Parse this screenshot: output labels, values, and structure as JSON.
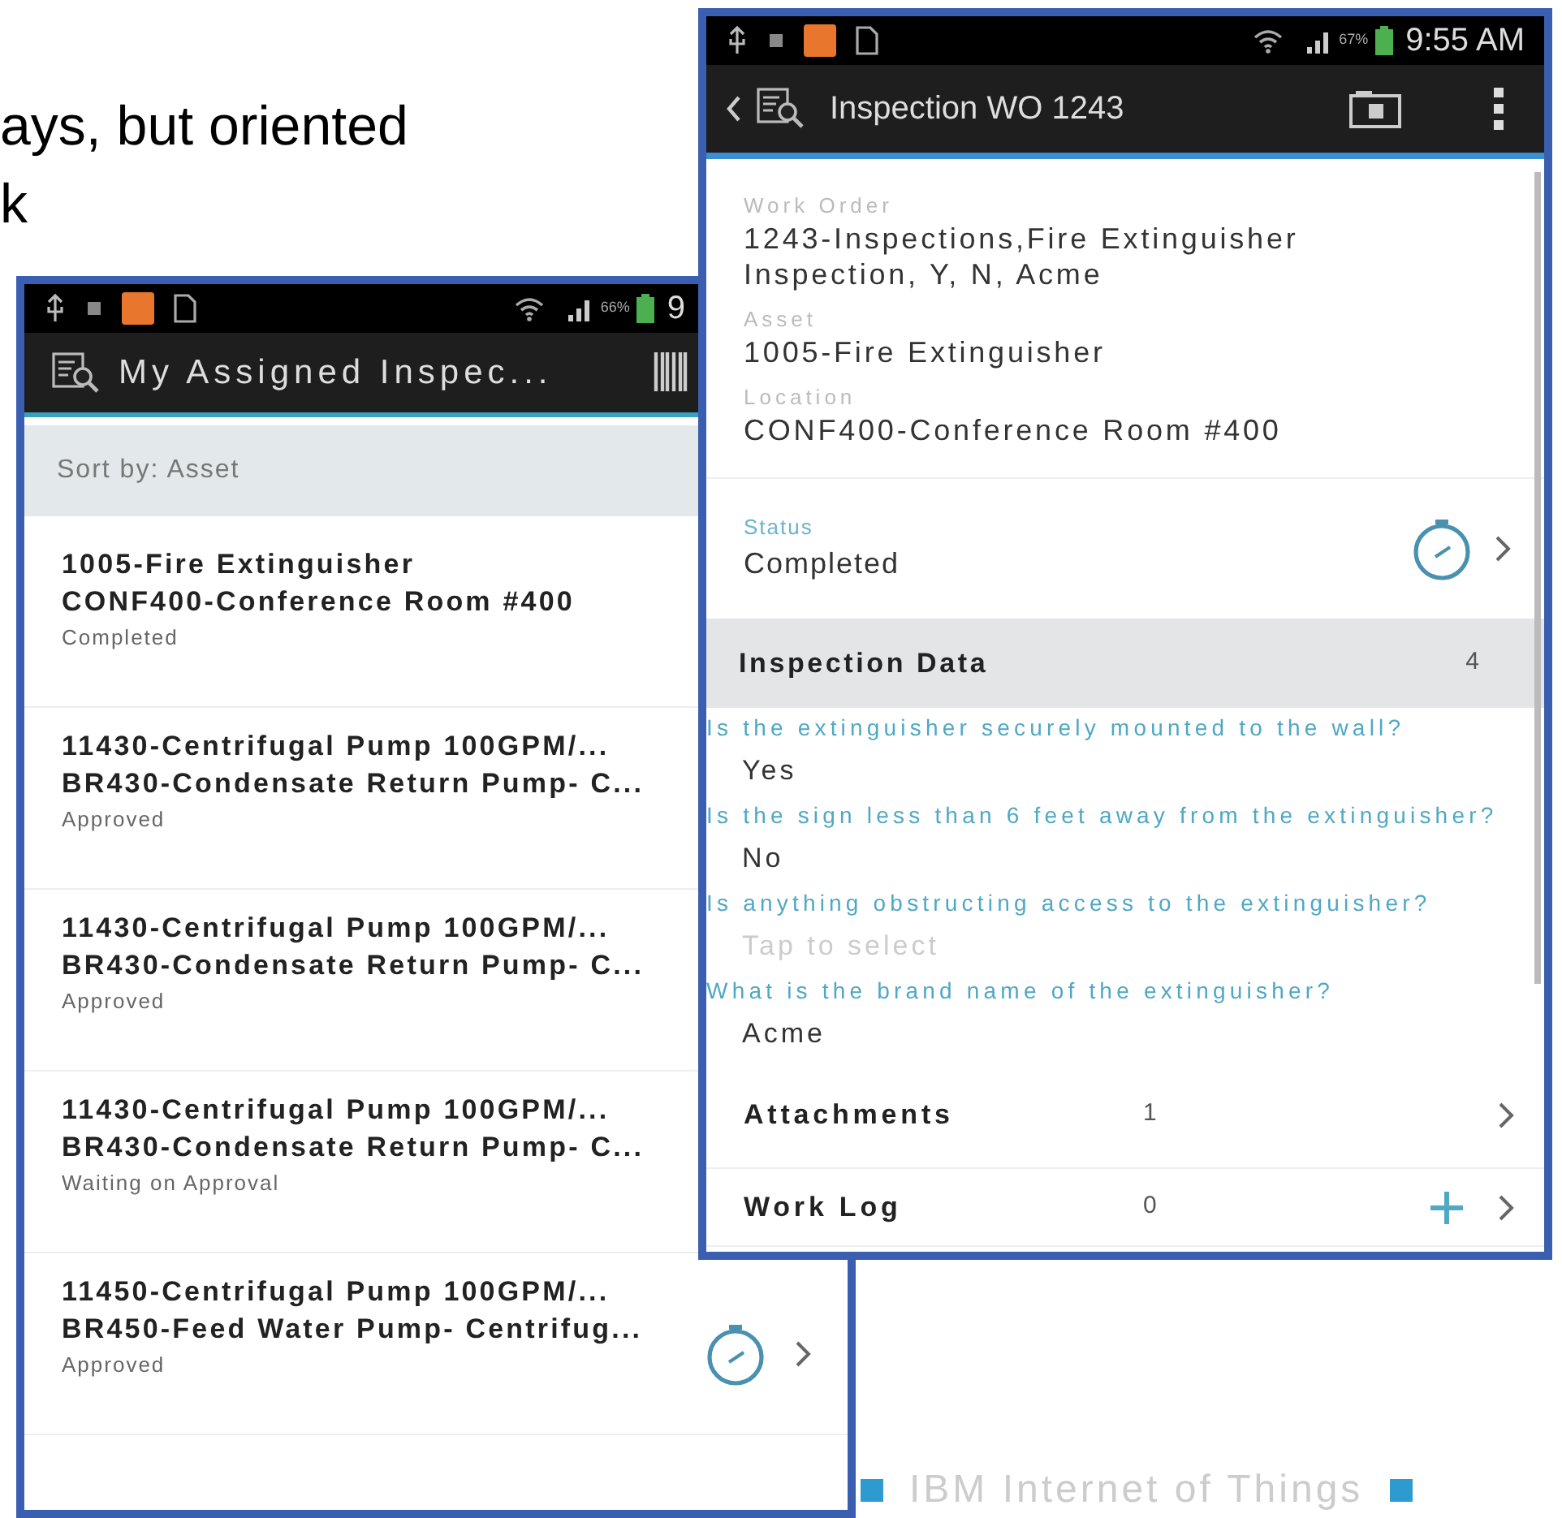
{
  "slide": {
    "text_lines": [
      "ays, but oriented",
      "k"
    ],
    "footer": "IBM Internet of Things"
  },
  "list_phone": {
    "status_bar": {
      "battery": "66%",
      "time": "9"
    },
    "app_bar": {
      "title": "My Assigned Inspec..."
    },
    "sort": "Sort by: Asset",
    "items": [
      {
        "title": "1005-Fire Extinguisher",
        "subtitle": "CONF400-Conference Room #400",
        "status": "Completed"
      },
      {
        "title": "11430-Centrifugal Pump 100GPM/...",
        "subtitle": "BR430-Condensate Return Pump- C...",
        "status": "Approved"
      },
      {
        "title": "11430-Centrifugal Pump 100GPM/...",
        "subtitle": "BR430-Condensate Return Pump- C...",
        "status": "Approved"
      },
      {
        "title": "11430-Centrifugal Pump 100GPM/...",
        "subtitle": "BR430-Condensate Return Pump- C...",
        "status": "Waiting on Approval"
      },
      {
        "title": "11450-Centrifugal Pump 100GPM/...",
        "subtitle": "BR450-Feed Water Pump- Centrifug...",
        "status": "Approved"
      }
    ]
  },
  "detail_phone": {
    "status_bar": {
      "battery": "67%",
      "time": "9:55 AM"
    },
    "app_bar": {
      "title": "Inspection WO 1243"
    },
    "fields": [
      {
        "label": "Work Order",
        "value": "1243-Inspections,Fire Extinguisher Inspection, Y, N, Acme"
      },
      {
        "label": "Asset",
        "value": "1005-Fire Extinguisher"
      },
      {
        "label": "Location",
        "value": "CONF400-Conference Room #400"
      }
    ],
    "status": {
      "label": "Status",
      "value": "Completed"
    },
    "section": {
      "title": "Inspection Data",
      "count": "4"
    },
    "questions": [
      {
        "question": "Is the extinguisher securely mounted to the wall?",
        "answer": "Yes"
      },
      {
        "question": "Is the sign less than 6 feet away from the extinguisher?",
        "answer": "No"
      },
      {
        "question": "Is anything obstructing access to the extinguisher?",
        "placeholder": "Tap to select"
      },
      {
        "question": "What is the brand name of the extinguisher?",
        "answer": "Acme"
      }
    ],
    "rows": [
      {
        "kind": "link",
        "label": "Attachments",
        "count": "1"
      },
      {
        "kind": "add",
        "label": "Work Log",
        "count": "0"
      }
    ]
  }
}
